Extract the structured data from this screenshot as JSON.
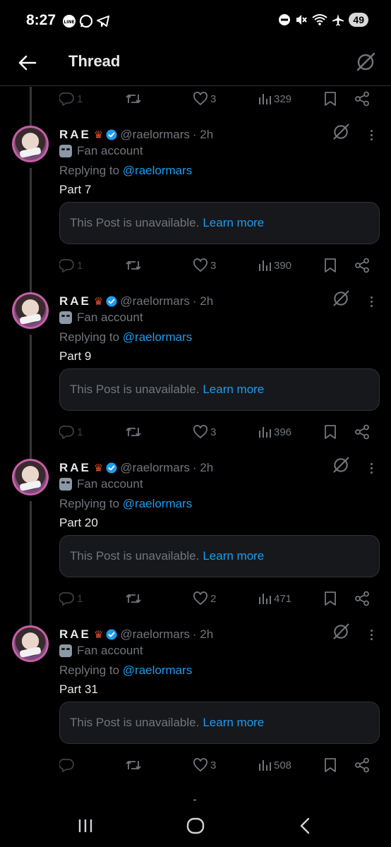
{
  "status_bar": {
    "time": "8:27",
    "battery": "49"
  },
  "header": {
    "title": "Thread"
  },
  "top_actions": {
    "replies": "1",
    "likes": "3",
    "views": "329"
  },
  "tweets": [
    {
      "name": "RAE",
      "handle": "@raelormars",
      "time": "· 2h",
      "badge": "Fan account",
      "replying_prefix": "Replying to",
      "replying_to": "@raelormars",
      "text": "Part 7",
      "unavailable": "This Post is unavailable.",
      "learn_more": "Learn more",
      "replies": "1",
      "likes": "3",
      "views": "390"
    },
    {
      "name": "RAE",
      "handle": "@raelormars",
      "time": "· 2h",
      "badge": "Fan account",
      "replying_prefix": "Replying to",
      "replying_to": "@raelormars",
      "text": "Part 9",
      "unavailable": "This Post is unavailable.",
      "learn_more": "Learn more",
      "replies": "1",
      "likes": "3",
      "views": "396"
    },
    {
      "name": "RAE",
      "handle": "@raelormars",
      "time": "· 2h",
      "badge": "Fan account",
      "replying_prefix": "Replying to",
      "replying_to": "@raelormars",
      "text": "Part 20",
      "unavailable": "This Post is unavailable.",
      "learn_more": "Learn more",
      "replies": "1",
      "likes": "2",
      "views": "471"
    },
    {
      "name": "RAE",
      "handle": "@raelormars",
      "time": "· 2h",
      "badge": "Fan account",
      "replying_prefix": "Replying to",
      "replying_to": "@raelormars",
      "text": "Part 31",
      "unavailable": "This Post is unavailable.",
      "learn_more": "Learn more",
      "replies": "",
      "likes": "3",
      "views": "508"
    }
  ],
  "icons": {
    "back": "arrow-left-icon",
    "grok": "grok-icon",
    "reply": "reply-icon",
    "retweet": "retweet-icon",
    "like": "heart-icon",
    "views": "views-icon",
    "bookmark": "bookmark-icon",
    "share": "share-icon",
    "more": "more-icon"
  },
  "colors": {
    "background": "#000000",
    "accent": "#1d9bf0",
    "muted": "#71767b",
    "text": "#e7e9ea"
  }
}
